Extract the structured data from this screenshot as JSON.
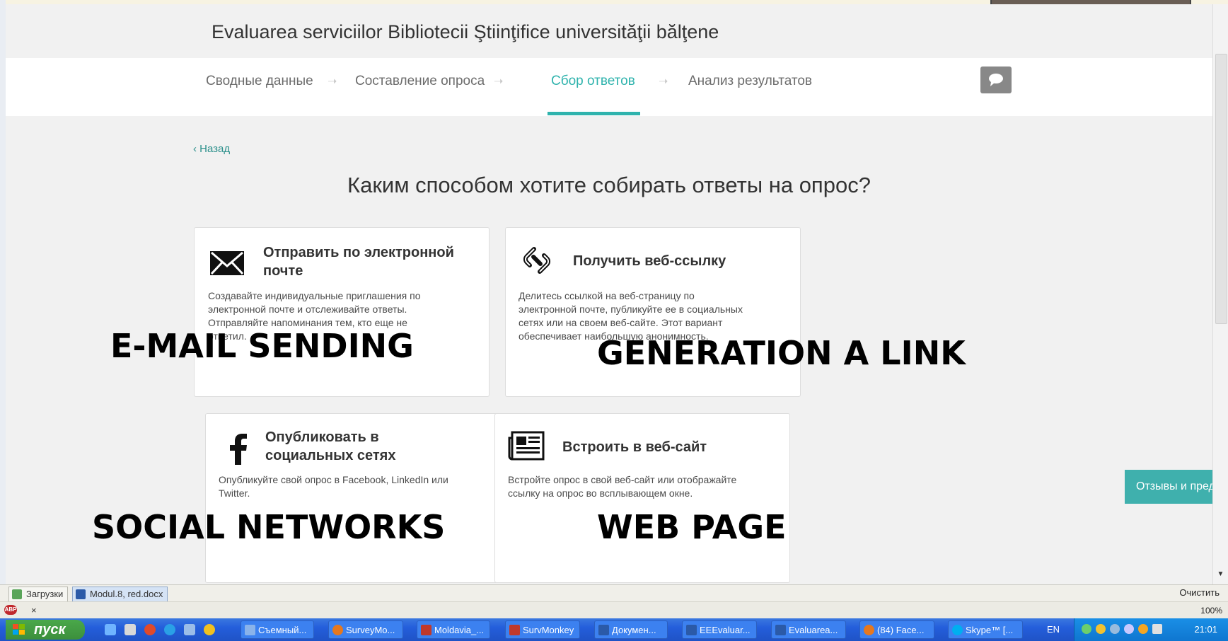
{
  "survey": {
    "title": "Evaluarea serviciilor Bibliotecii Ştiinţifice universităţii bălţene"
  },
  "nav": {
    "steps": [
      {
        "label": "Сводные данные"
      },
      {
        "label": "Составление опроса"
      },
      {
        "label": "Сбор ответов",
        "active": true
      },
      {
        "label": "Анализ результатов"
      }
    ],
    "arrow": "➝"
  },
  "page": {
    "back": "Назад",
    "back_chevron": "‹",
    "question": "Каким способом хотите собирать ответы на опрос?"
  },
  "cards": [
    {
      "icon": "envelope-icon",
      "title_line1": "Отправить по электронной",
      "title_line2": "почте",
      "desc": [
        "Создавайте индивидуальные приглашения по",
        "электронной почте и отслеживайте ответы.",
        "Отправляйте напоминания тем, кто еще не",
        "ответил."
      ]
    },
    {
      "icon": "link-icon",
      "title_line1": "Получить веб-ссылку",
      "desc": [
        "Делитесь ссылкой на веб-страницу по",
        "электронной почте, публикуйте ее в социальных",
        "сетях или на своем веб-сайте. Этот вариант",
        "обеспечивает наибольшую анонимность."
      ]
    },
    {
      "icon": "facebook-icon",
      "title_line1": "Опубликовать в",
      "title_line2": "социальных сетях",
      "desc": [
        "Опубликуйте свой опрос в Facebook, LinkedIn или",
        "Twitter."
      ]
    },
    {
      "icon": "newspaper-icon",
      "title_line1": "Встроить в веб-сайт",
      "desc": [
        "Встройте опрос в свой веб-сайт или отображайте",
        "ссылку на опрос во всплывающем окне."
      ]
    }
  ],
  "overlays": {
    "email": "E-MAIL SENDING",
    "link": "GENERATION A  LINK",
    "social": "SOCIAL NETWORKS",
    "web": "WEB PAGE"
  },
  "feedback_tab": "Отзывы и пред",
  "downloads": {
    "items": [
      "Загрузки",
      "Modul.8, red.docx"
    ],
    "clear": "Очистить"
  },
  "status": {
    "close": "×",
    "zoom": "100%"
  },
  "taskbar": {
    "start": "пуск",
    "tasks": [
      "Съемный...",
      "SurveyMo...",
      "Moldavia_...",
      "SurvMonkey",
      "Докумен...",
      "EEEvaluar...",
      "Evaluarea...",
      "(84) Face...",
      "Skype™ [..."
    ],
    "lang": "EN",
    "clock": "21:01"
  },
  "colors": {
    "accent": "#2fb3ad",
    "taskbar": "#245edb",
    "start": "#3c8f3c"
  }
}
